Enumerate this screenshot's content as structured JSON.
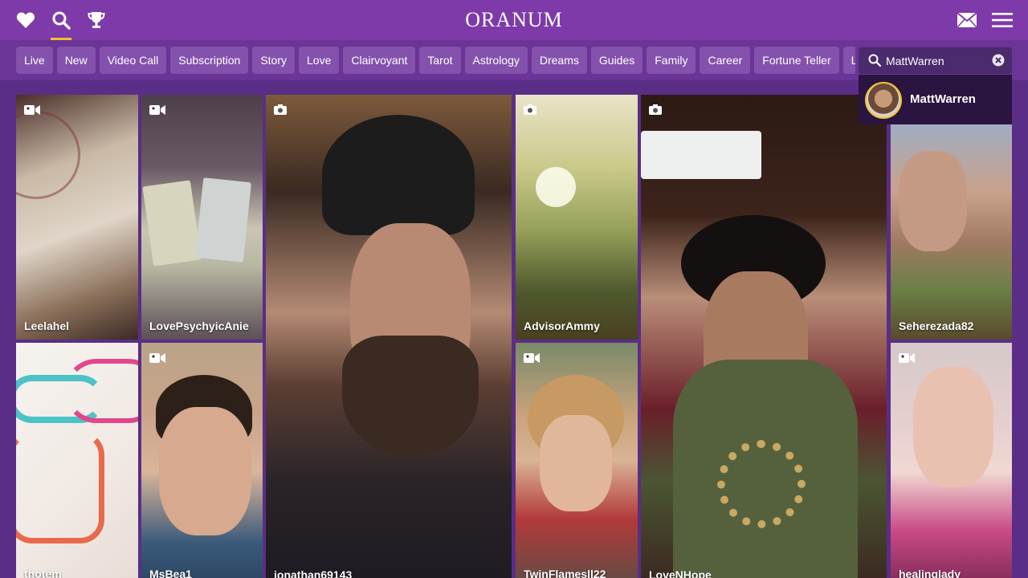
{
  "header": {
    "logo": "ORANUM",
    "icons": [
      "heart-icon",
      "search-icon",
      "trophy-icon",
      "mail-icon",
      "menu-icon"
    ],
    "accent_color": "#f2c12e"
  },
  "filters": {
    "chips": [
      "Live",
      "New",
      "Video Call",
      "Subscription",
      "Story",
      "Love",
      "Clairvoyant",
      "Tarot",
      "Astrology",
      "Dreams",
      "Guides",
      "Family",
      "Career",
      "Fortune Teller",
      "L"
    ]
  },
  "search": {
    "value": "MattWarren",
    "placeholder": "",
    "suggestion": {
      "name": "MattWarren"
    }
  },
  "tiles": [
    {
      "name": "Leelahel",
      "badge": "video-camera-icon"
    },
    {
      "name": "LovePsychyicAnie",
      "badge": "video-camera-icon"
    },
    {
      "name": "jonathan69143",
      "badge": "photo-camera-icon"
    },
    {
      "name": "AdvisorAmmy",
      "badge": "photo-camera-icon"
    },
    {
      "name": "LoveNHope",
      "badge": "photo-camera-icon"
    },
    {
      "name": "Seherezada82",
      "badge": "video-camera-icon"
    },
    {
      "name": "thotem",
      "badge": ""
    },
    {
      "name": "MsBea1",
      "badge": "video-camera-icon"
    },
    {
      "name": "TwinFlamesll22",
      "badge": "video-camera-icon"
    },
    {
      "name": "healinglady",
      "badge": "video-camera-icon"
    }
  ]
}
